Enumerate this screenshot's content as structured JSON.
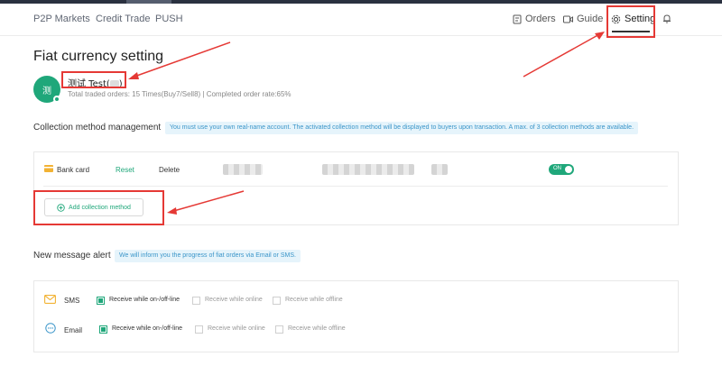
{
  "nav": {
    "left_items": [
      "P2P Markets",
      "Credit Trade",
      "PUSH"
    ],
    "orders_label": "Orders",
    "guide_label": "Guide",
    "setting_label": "Setting"
  },
  "page": {
    "title": "Fiat currency setting"
  },
  "user": {
    "avatar_text": "测",
    "name": "测试 Test(",
    "name_suffix": ")",
    "stats": "Total traded orders: 15 Times(Buy7/Sell8)  |  Completed order rate:65%"
  },
  "collection": {
    "title": "Collection method management",
    "notice": "You must use your own real-name account. The activated collection method will be displayed to buyers upon transaction. A max. of 3 collection methods are available.",
    "method": {
      "label": "Bank card",
      "reset": "Reset",
      "delete": "Delete",
      "toggle_text": "ON",
      "enabled": true
    },
    "add_button": "Add collection method"
  },
  "alert": {
    "title": "New message alert",
    "notice": "We will inform you the progress of fiat orders via Email or SMS.",
    "rows": [
      {
        "label": "SMS",
        "icon": "envelope-icon",
        "options": [
          {
            "label": "Receive while on-/off-line",
            "checked": true
          },
          {
            "label": "Receive while online",
            "checked": false
          },
          {
            "label": "Receive while offline",
            "checked": false
          }
        ]
      },
      {
        "label": "Email",
        "icon": "chat-bubble-icon",
        "options": [
          {
            "label": "Receive while on-/off-line",
            "checked": true
          },
          {
            "label": "Receive while online",
            "checked": false
          },
          {
            "label": "Receive while offline",
            "checked": false
          }
        ]
      }
    ]
  },
  "colors": {
    "accent": "#1fa77a",
    "annotation": "#e53935",
    "notice_bg": "#e6f4fb",
    "notice_text": "#3a95c9"
  }
}
